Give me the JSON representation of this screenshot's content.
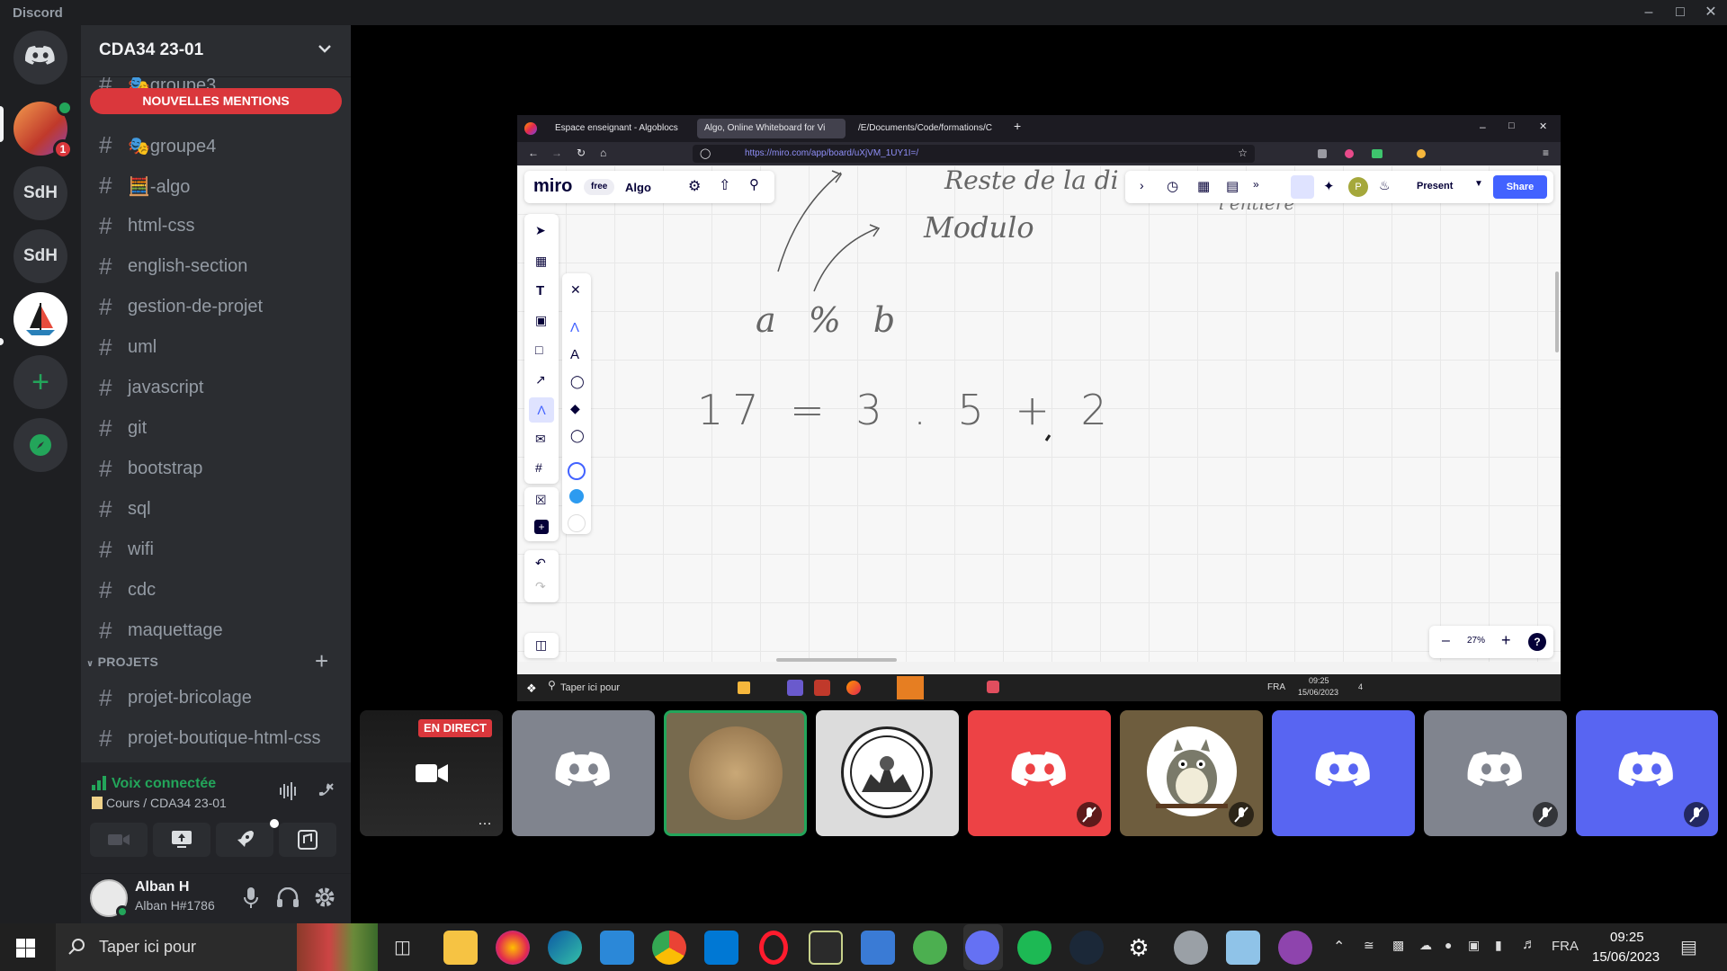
{
  "app": {
    "title": "Discord"
  },
  "servers": [
    {
      "label": "SdH"
    },
    {
      "label": "SdH"
    }
  ],
  "unread_badge": "1",
  "server": {
    "name": "CDA34 23-01"
  },
  "mentions_banner": "NOUVELLES MENTIONS",
  "channels": [
    {
      "name": "groupe3",
      "emoji": "🎭"
    },
    {
      "name": "groupe4",
      "emoji": "🎭"
    },
    {
      "name": "-algo",
      "emoji": "🧮"
    },
    {
      "name": "html-css"
    },
    {
      "name": "english-section"
    },
    {
      "name": "gestion-de-projet"
    },
    {
      "name": "uml"
    },
    {
      "name": "javascript"
    },
    {
      "name": "git"
    },
    {
      "name": "bootstrap"
    },
    {
      "name": "sql"
    },
    {
      "name": "wifi"
    },
    {
      "name": "cdc"
    },
    {
      "name": "maquettage"
    }
  ],
  "category": {
    "name": "PROJETS"
  },
  "project_channels": [
    {
      "name": "projet-bricolage"
    },
    {
      "name": "projet-boutique-html-css"
    }
  ],
  "voice": {
    "status": "Voix connectée",
    "location": "Cours / CDA34 23-01"
  },
  "user": {
    "name": "Alban H",
    "tag": "Alban H#1786"
  },
  "live_tile": {
    "badge": "EN DIRECT"
  },
  "browser": {
    "tabs": [
      "Espace enseignant - Algoblocs",
      "Algo, Online Whiteboard for Vi",
      "/E/Documents/Code/formations/C"
    ],
    "url": "https://miro.com/app/board/uXjVM_1UY1I=/"
  },
  "miro": {
    "logo": "miro",
    "plan": "free",
    "board_name": "Algo",
    "present_label": "Present",
    "share_label": "Share",
    "zoom": "27%",
    "handwriting": {
      "line1": "Reste de la di",
      "line2": "Modulo",
      "line3": "a % b",
      "line4": "17 = 3 . 5 + 2",
      "line5": "l'entiere"
    },
    "inner_taskbar": {
      "search_placeholder": "Taper ici pour",
      "lang": "FRA",
      "time": "09:25",
      "date": "15/06/2023",
      "notif": "4"
    }
  },
  "taskbar": {
    "search_placeholder": "Taper ici pour",
    "lang": "FRA",
    "time": "09:25",
    "date": "15/06/2023"
  },
  "colors": {
    "blurple": "#5865f2",
    "red": "#da373c",
    "green": "#23a55a",
    "grey_tile": "#80848e"
  }
}
